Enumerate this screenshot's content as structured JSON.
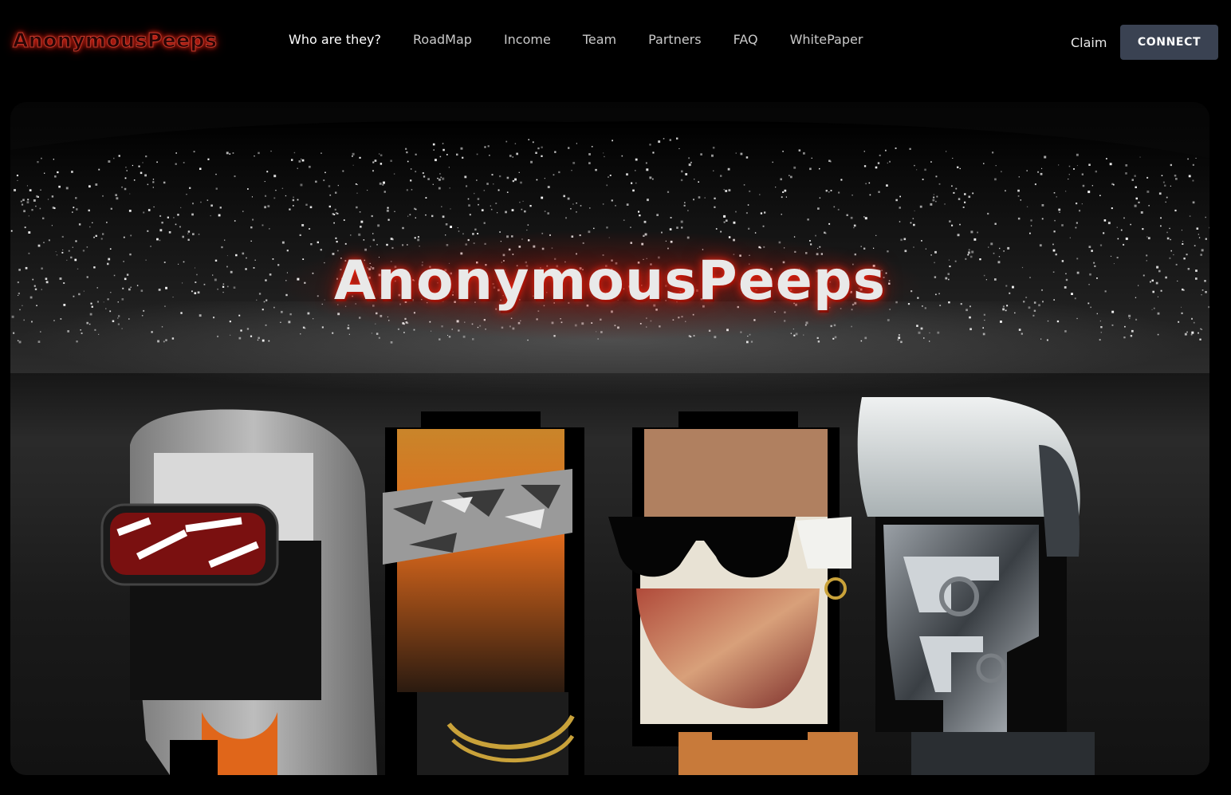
{
  "header": {
    "logo": "AnonymousPeeps",
    "nav": [
      {
        "label": "Who are they?"
      },
      {
        "label": "RoadMap"
      },
      {
        "label": "Income"
      },
      {
        "label": "Team"
      },
      {
        "label": "Partners"
      },
      {
        "label": "FAQ"
      },
      {
        "label": "WhitePaper"
      }
    ],
    "claim_label": "Claim",
    "connect_label": "CONNECT"
  },
  "hero": {
    "title": "AnonymousPeeps"
  },
  "colors": {
    "background": "#000000",
    "connect_button": "#3a4252",
    "logo_glow": "#ff2a1a"
  }
}
